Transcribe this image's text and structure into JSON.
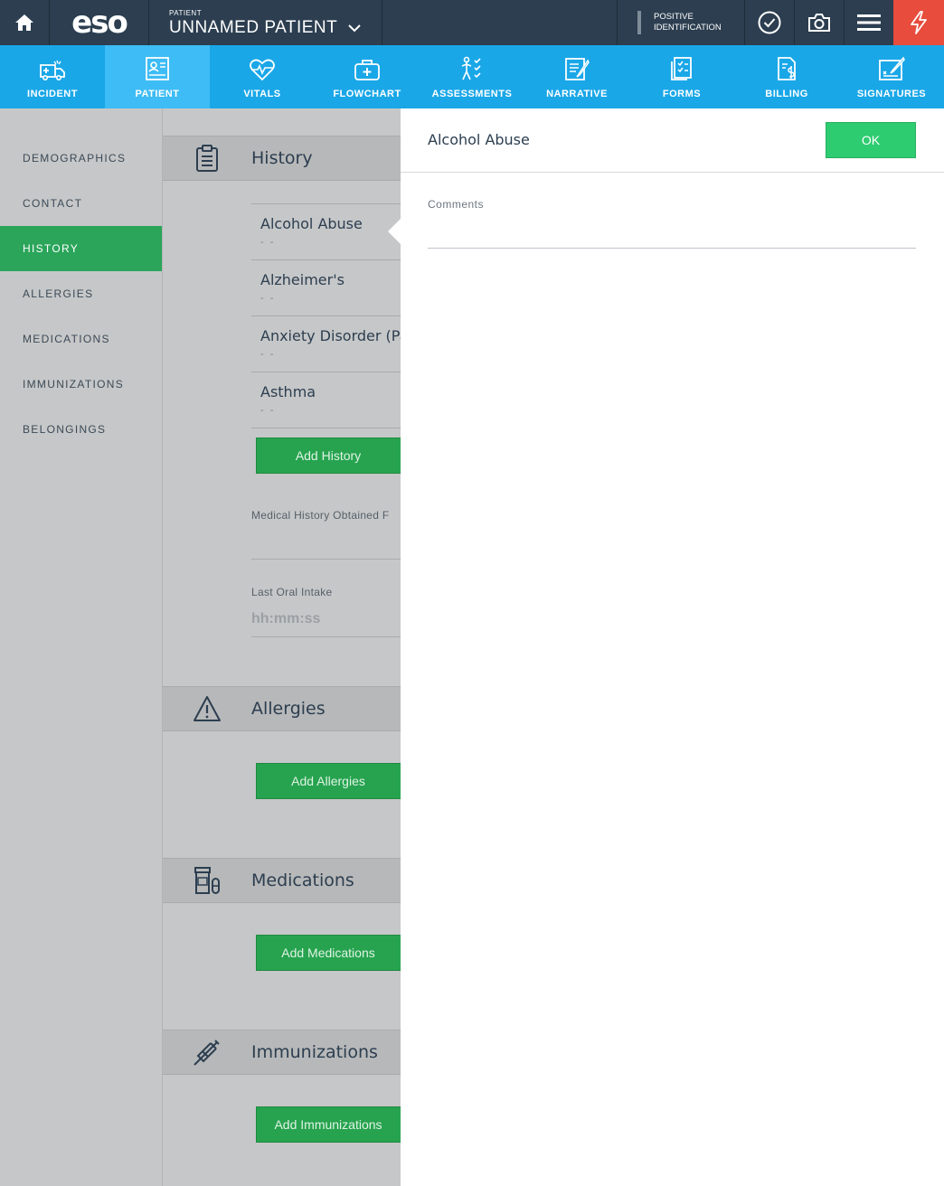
{
  "topbar": {
    "home_icon": "home-icon",
    "logo": "eso",
    "patient_small_label": "PATIENT",
    "patient_name": "UNNAMED PATIENT",
    "positive_id_line1": "POSITIVE",
    "positive_id_line2": "IDENTIFICATION",
    "icons": [
      "check-circle-icon",
      "camera-icon",
      "menu-icon",
      "lightning-icon"
    ],
    "colors": {
      "background": "#2c3e50",
      "bolt_bg": "#e74c3c"
    }
  },
  "nav": {
    "items": [
      {
        "label": "INCIDENT",
        "icon": "ambulance-icon"
      },
      {
        "label": "PATIENT",
        "icon": "patient-card-icon",
        "active": true
      },
      {
        "label": "VITALS",
        "icon": "heart-pulse-icon"
      },
      {
        "label": "FLOWCHART",
        "icon": "medkit-icon"
      },
      {
        "label": "ASSESSMENTS",
        "icon": "assessment-body-icon"
      },
      {
        "label": "NARRATIVE",
        "icon": "narrative-pen-icon"
      },
      {
        "label": "FORMS",
        "icon": "forms-checklist-icon"
      },
      {
        "label": "BILLING",
        "icon": "billing-dollar-icon"
      },
      {
        "label": "SIGNATURES",
        "icon": "signature-icon"
      }
    ],
    "colors": {
      "background": "#1aa7e8",
      "active": "#3dbcf5"
    }
  },
  "sidebar": {
    "items": [
      {
        "label": "DEMOGRAPHICS"
      },
      {
        "label": "CONTACT"
      },
      {
        "label": "HISTORY",
        "active": true
      },
      {
        "label": "ALLERGIES"
      },
      {
        "label": "MEDICATIONS"
      },
      {
        "label": "IMMUNIZATIONS"
      },
      {
        "label": "BELONGINGS"
      }
    ],
    "active_color": "#2aa55a"
  },
  "content": {
    "history": {
      "title": "History",
      "items": [
        {
          "name": "Alcohol Abuse",
          "value": "- -"
        },
        {
          "name": "Alzheimer's",
          "value": "- -"
        },
        {
          "name": "Anxiety Disorder (Pa",
          "value": "- -"
        },
        {
          "name": "Asthma",
          "value": "- -"
        }
      ],
      "add_button": "Add History",
      "obtained_from_label": "Medical History Obtained F",
      "last_oral_intake_label": "Last Oral Intake",
      "last_oral_intake_placeholder": "hh:mm:ss"
    },
    "allergies": {
      "title": "Allergies",
      "add_button": "Add Allergies"
    },
    "medications": {
      "title": "Medications",
      "add_button": "Add Medications"
    },
    "immunizations": {
      "title": "Immunizations",
      "add_button": "Add Immunizations"
    }
  },
  "panel": {
    "title": "Alcohol Abuse",
    "ok_label": "OK",
    "comments_label": "Comments",
    "comments_value": ""
  }
}
